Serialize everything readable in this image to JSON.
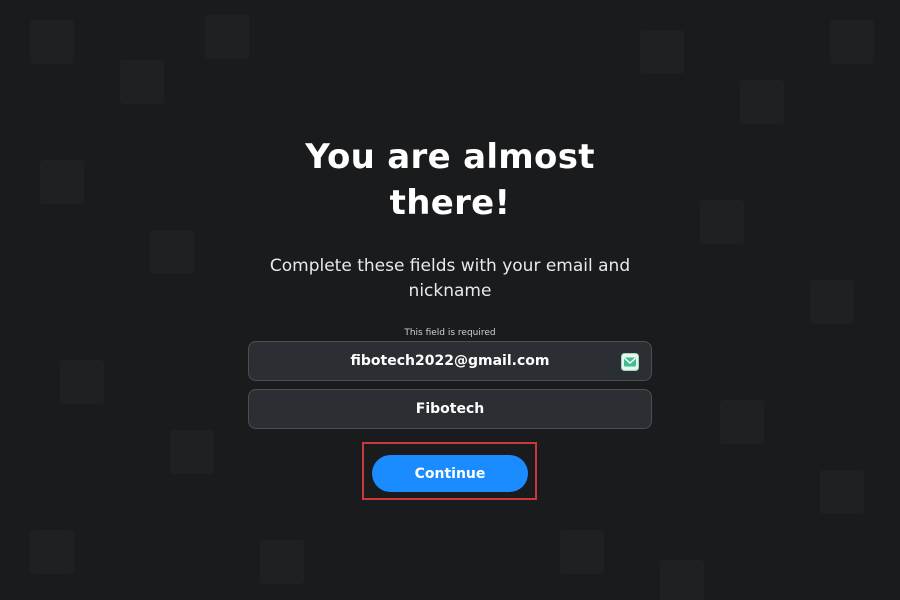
{
  "heading": {
    "title": "You are almost there!",
    "subtitle": "Complete these fields with your email and nickname"
  },
  "form": {
    "required_note": "This field is required",
    "email": {
      "value": "fibotech2022@gmail.com",
      "icon": "mail-icon"
    },
    "nickname": {
      "value": "Fibotech"
    },
    "continue_label": "Continue"
  },
  "colors": {
    "background": "#1b1c1e",
    "field_background": "#2b2e32",
    "button": "#1a8cff",
    "highlight": "#c9383a",
    "mail_icon": "#3fbf8f"
  }
}
